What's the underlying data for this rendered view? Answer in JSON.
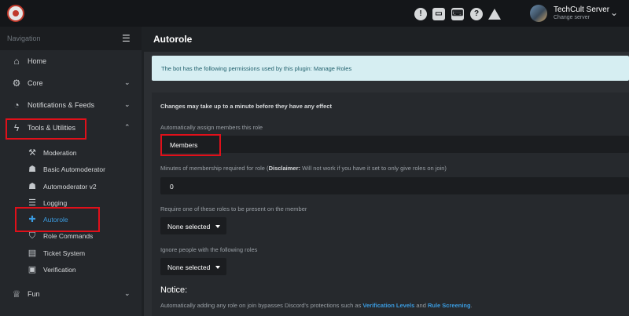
{
  "topbar": {
    "icons": [
      "bulb-icon",
      "chat-icon",
      "keyboard-icon",
      "help-icon",
      "warning-icon"
    ],
    "server_name": "TechCult Server",
    "server_sub": "Change server"
  },
  "sidebar": {
    "title": "Navigation",
    "items": [
      {
        "label": "Home",
        "icon": "home-icon"
      },
      {
        "label": "Core",
        "icon": "gears-icon"
      },
      {
        "label": "Notifications & Feeds",
        "icon": "rss-icon"
      },
      {
        "label": "Tools & Utilities",
        "icon": "bolt-icon"
      },
      {
        "label": "Fun",
        "icon": "trophy-icon"
      }
    ],
    "sub_items": [
      {
        "label": "Moderation",
        "icon": "hammer-icon"
      },
      {
        "label": "Basic Automoderator",
        "icon": "robot-icon"
      },
      {
        "label": "Automoderator v2",
        "icon": "robot-icon"
      },
      {
        "label": "Logging",
        "icon": "database-icon"
      },
      {
        "label": "Autorole",
        "icon": "user-plus-icon"
      },
      {
        "label": "Role Commands",
        "icon": "tags-icon"
      },
      {
        "label": "Ticket System",
        "icon": "ticket-icon"
      },
      {
        "label": "Verification",
        "icon": "id-card-icon"
      }
    ]
  },
  "main": {
    "title": "Autorole",
    "info": "The bot has the following permissions used by this plugin: Manage Roles",
    "note": "Changes may take up to a minute before they have any effect",
    "assign_label": "Automatically assign members this role",
    "assign_value": "Members",
    "minutes_label": "Minutes of membership required for role (",
    "minutes_disclaimer": "Disclaimer:",
    "minutes_label_rest": " Will not work if you have it set to only give roles on join)",
    "minutes_value": "0",
    "require_label": "Require one of these roles to be present on the member",
    "require_value": "None selected",
    "ignore_label": "Ignore people with the following roles",
    "ignore_value": "None selected",
    "notice_title": "Notice:",
    "notice_text": "Automatically adding any role on join bypasses Discord's protections such as ",
    "notice_link1": "Verification Levels",
    "notice_and": " and ",
    "notice_link2": "Rule Screening",
    "notice_end": "."
  },
  "colors": {
    "accent": "#3a9be0",
    "highlight": "#e0101a",
    "info_bg": "#d6eef2"
  }
}
